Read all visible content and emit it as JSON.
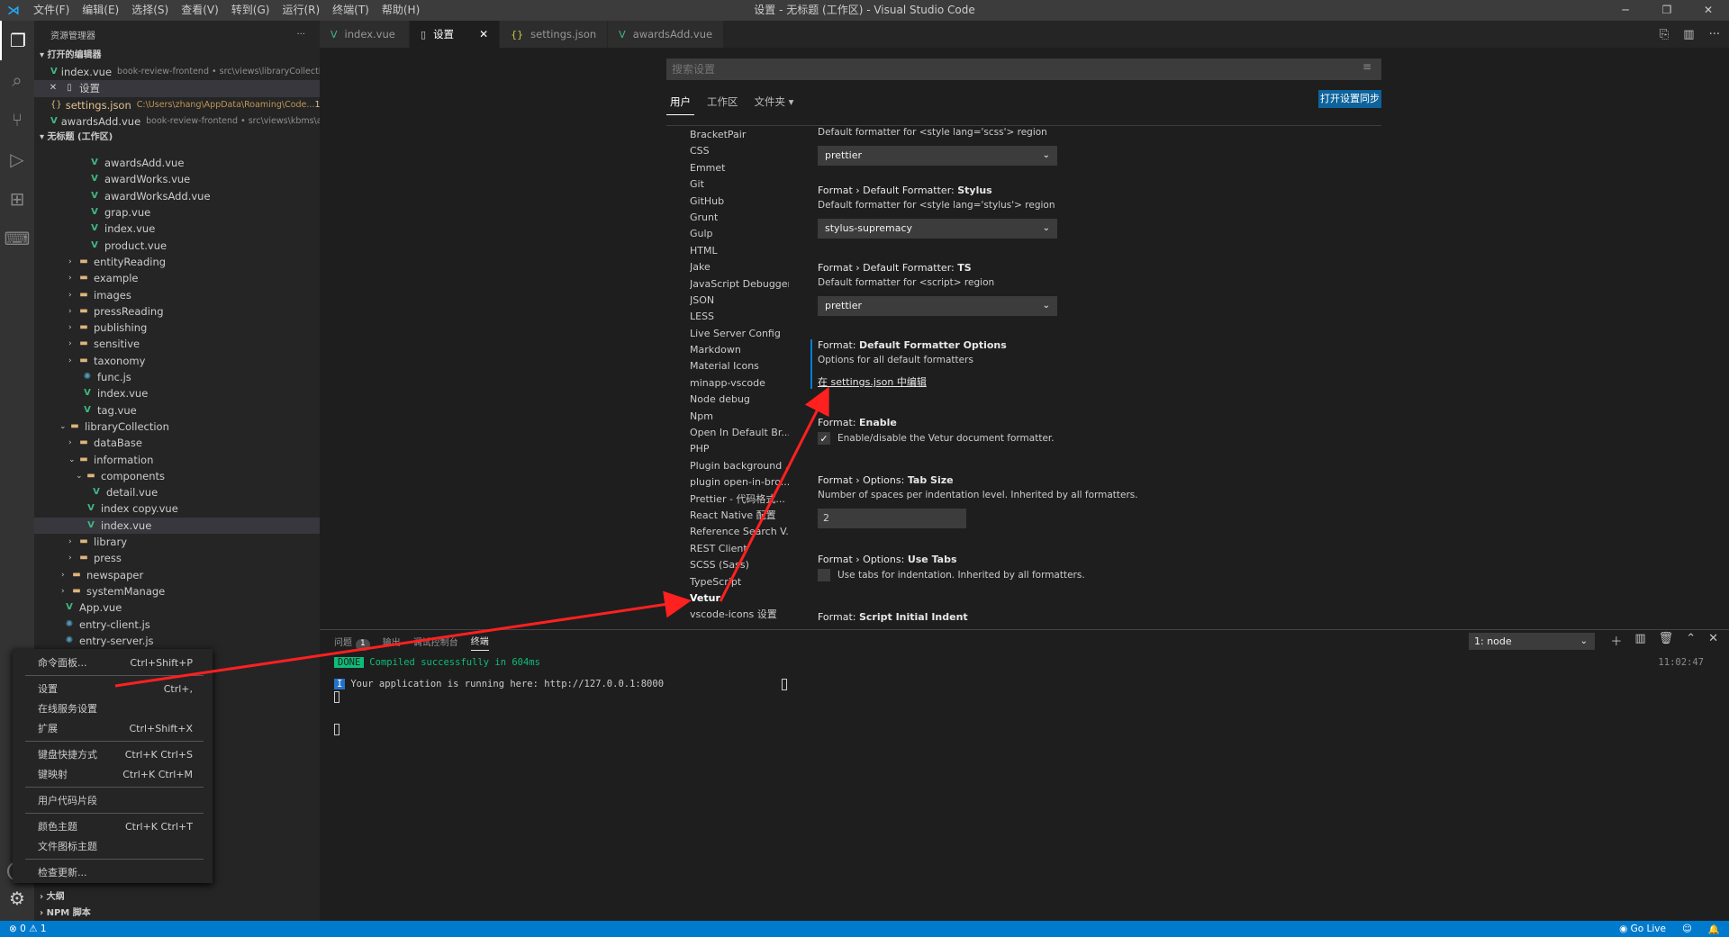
{
  "window": {
    "title": "设置 - 无标题 (工作区) - Visual Studio Code",
    "menu": [
      "文件(F)",
      "编辑(E)",
      "选择(S)",
      "查看(V)",
      "转到(G)",
      "运行(R)",
      "终端(T)",
      "帮助(H)"
    ]
  },
  "sidebar": {
    "title": "资源管理器",
    "more": "···",
    "open_editors_title": "打开的编辑器",
    "open_editors": [
      {
        "name": "index.vue",
        "path": "book-review-frontend • src\\views\\libraryCollectio...",
        "icon": "vue"
      },
      {
        "name": "设置",
        "path": "",
        "icon": "file"
      },
      {
        "name": "settings.json",
        "path": "C:\\Users\\zhang\\AppData\\Roaming\\Code...",
        "icon": "json",
        "badge": "1"
      },
      {
        "name": "awardsAdd.vue",
        "path": "book-review-frontend • src\\views\\kbms\\a...",
        "icon": "vue"
      }
    ],
    "workspace_title": "无标题 (工作区)",
    "tree": [
      {
        "name": "awardsAdd.vue",
        "type": "vue"
      },
      {
        "name": "awardWorks.vue",
        "type": "vue"
      },
      {
        "name": "awardWorksAdd.vue",
        "type": "vue"
      },
      {
        "name": "grap.vue",
        "type": "vue"
      },
      {
        "name": "index.vue",
        "type": "vue"
      },
      {
        "name": "product.vue",
        "type": "vue"
      },
      {
        "name": "entityReading",
        "type": "folder"
      },
      {
        "name": "example",
        "type": "folder"
      },
      {
        "name": "images",
        "type": "folder"
      },
      {
        "name": "pressReading",
        "type": "folder"
      },
      {
        "name": "publishing",
        "type": "folder"
      },
      {
        "name": "sensitive",
        "type": "folder"
      },
      {
        "name": "taxonomy",
        "type": "folder"
      },
      {
        "name": "func.js",
        "type": "js"
      },
      {
        "name": "index.vue",
        "type": "vue"
      },
      {
        "name": "tag.vue",
        "type": "vue"
      },
      {
        "name": "libraryCollection",
        "type": "folder-open"
      },
      {
        "name": "dataBase",
        "type": "folder"
      },
      {
        "name": "information",
        "type": "folder-open"
      },
      {
        "name": "components",
        "type": "folder-open"
      },
      {
        "name": "detail.vue",
        "type": "vue"
      },
      {
        "name": "index copy.vue",
        "type": "vue"
      },
      {
        "name": "index.vue",
        "type": "vue"
      },
      {
        "name": "library",
        "type": "folder"
      },
      {
        "name": "press",
        "type": "folder"
      },
      {
        "name": "newspaper",
        "type": "folder"
      },
      {
        "name": "systemManage",
        "type": "folder"
      },
      {
        "name": "App.vue",
        "type": "vue"
      },
      {
        "name": "entry-client.js",
        "type": "js"
      },
      {
        "name": "entry-server.js",
        "type": "js"
      }
    ],
    "outline_title": "大纲",
    "npm_title": "NPM 脚本"
  },
  "tabs": [
    {
      "label": "index.vue",
      "icon": "vue"
    },
    {
      "label": "设置",
      "icon": "file",
      "active": true
    },
    {
      "label": "settings.json",
      "icon": "json"
    },
    {
      "label": "awardsAdd.vue",
      "icon": "vue"
    }
  ],
  "settings": {
    "search_placeholder": "搜索设置",
    "scopes": [
      "用户",
      "工作区",
      "文件夹 ▾"
    ],
    "sync_button": "打开设置同步",
    "toc": [
      "BracketPair",
      "CSS",
      "Emmet",
      "Git",
      "GitHub",
      "Grunt",
      "Gulp",
      "HTML",
      "Jake",
      "JavaScript Debugger",
      "JSON",
      "LESS",
      "Live Server Config",
      "Markdown",
      "Material Icons",
      "minapp-vscode",
      "Node debug",
      "Npm",
      "Open In Default Br...",
      "PHP",
      "Plugin background ...",
      "plugin open-in-bro...",
      "Prettier - 代码格式...",
      "React Native 配置",
      "Reference Search V...",
      "REST Client",
      "SCSS (Sass)",
      "TypeScript",
      "Vetur",
      "vscode-icons 设置"
    ],
    "toc_active": "Vetur",
    "items": {
      "scss_desc": "Default formatter for <style lang='scss'> region",
      "scss_value": "prettier",
      "stylus_prefix": "Format › Default Formatter: ",
      "stylus_name": "Stylus",
      "stylus_desc": "Default formatter for <style lang='stylus'> region",
      "stylus_value": "stylus-supremacy",
      "ts_prefix": "Format › Default Formatter: ",
      "ts_name": "TS",
      "ts_desc": "Default formatter for <script> region",
      "ts_value": "prettier",
      "opts_prefix": "Format: ",
      "opts_name": "Default Formatter Options",
      "opts_desc": "Options for all default formatters",
      "opts_link": "在 settings.json 中编辑",
      "enable_prefix": "Format: ",
      "enable_name": "Enable",
      "enable_desc": "Enable/disable the Vetur document formatter.",
      "tab_prefix": "Format › Options: ",
      "tab_name": "Tab Size",
      "tab_desc": "Number of spaces per indentation level. Inherited by all formatters.",
      "tab_value": "2",
      "usetabs_prefix": "Format › Options: ",
      "usetabs_name": "Use Tabs",
      "usetabs_desc": "Use tabs for indentation. Inherited by all formatters.",
      "script_prefix": "Format: ",
      "script_name": "Script Initial Indent"
    }
  },
  "panel": {
    "tabs": [
      "问题",
      "输出",
      "调试控制台",
      "终端"
    ],
    "problems_count": "1",
    "terminal_select": "1: node",
    "terminal": {
      "done_tag": "DONE",
      "done_text": "Compiled successfully in 604ms",
      "time": "11:02:47",
      "info_tag": "I",
      "info_text": "Your application is running here: http://127.0.0.1:8000"
    }
  },
  "context_menu": [
    {
      "label": "命令面板...",
      "kb": "Ctrl+Shift+P"
    },
    {
      "sep": true
    },
    {
      "label": "设置",
      "kb": "Ctrl+,"
    },
    {
      "label": "在线服务设置",
      "kb": ""
    },
    {
      "label": "扩展",
      "kb": "Ctrl+Shift+X"
    },
    {
      "sep": true
    },
    {
      "label": "键盘快捷方式",
      "kb": "Ctrl+K Ctrl+S"
    },
    {
      "label": "键映射",
      "kb": "Ctrl+K Ctrl+M"
    },
    {
      "sep": true
    },
    {
      "label": "用户代码片段",
      "kb": ""
    },
    {
      "sep": true
    },
    {
      "label": "颜色主题",
      "kb": "Ctrl+K Ctrl+T"
    },
    {
      "label": "文件图标主题",
      "kb": ""
    },
    {
      "sep": true
    },
    {
      "label": "检查更新...",
      "kb": ""
    }
  ],
  "statusbar": {
    "problems": "⊗ 0 ⚠ 1",
    "golive": "Go Live"
  },
  "colors": {
    "accent": "#007acc",
    "annotation_arrow": "#ff2020",
    "vue": "#41b883",
    "folder": "#dcb67a"
  }
}
